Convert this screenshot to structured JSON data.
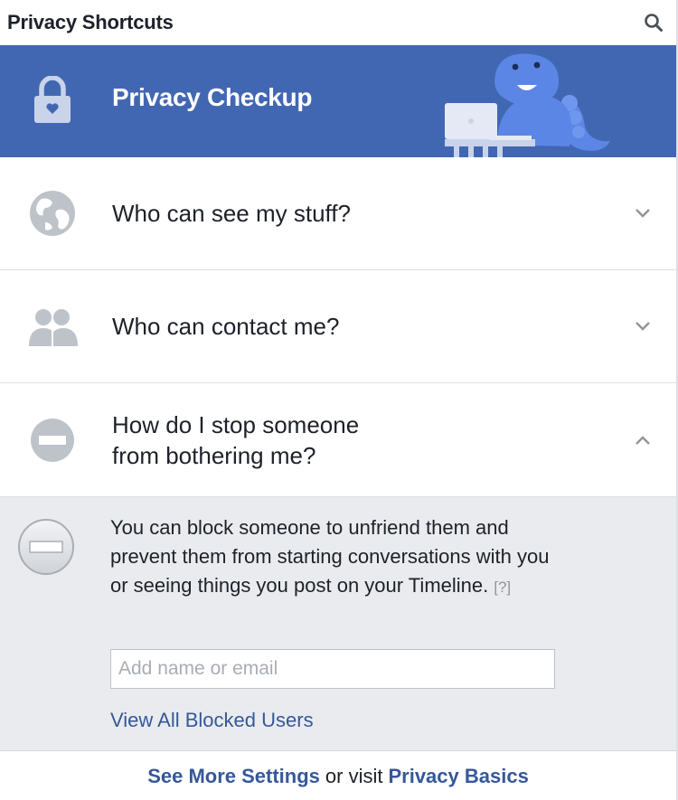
{
  "header": {
    "title": "Privacy Shortcuts",
    "search_icon": "search-icon"
  },
  "banner": {
    "title": "Privacy Checkup",
    "icon": "lock-icon",
    "background": "#4267b2"
  },
  "sections": [
    {
      "label": "Who can see my stuff?",
      "icon": "globe-icon",
      "chevron": "chevron-down-icon",
      "expanded": false
    },
    {
      "label": "Who can contact me?",
      "icon": "people-icon",
      "chevron": "chevron-down-icon",
      "expanded": false
    },
    {
      "label_line1": "How do I stop someone",
      "label_line2": "from bothering me?",
      "icon": "block-icon",
      "chevron": "chevron-up-icon",
      "expanded": true
    }
  ],
  "block_panel": {
    "description": "You can block someone to unfriend them and prevent them from starting conversations with you or seeing things you post on your Timeline.",
    "help_link": "[?]",
    "input_placeholder": "Add name or email",
    "input_value": "",
    "view_blocked_label": "View All Blocked Users"
  },
  "footer": {
    "see_more_label": "See More Settings",
    "or_visit_text": "or visit",
    "privacy_basics_label": "Privacy Basics"
  },
  "colors": {
    "brand_blue": "#4267b2",
    "link_blue": "#365899",
    "icon_gray": "#bec3c9",
    "panel_gray": "#e9ebee"
  }
}
